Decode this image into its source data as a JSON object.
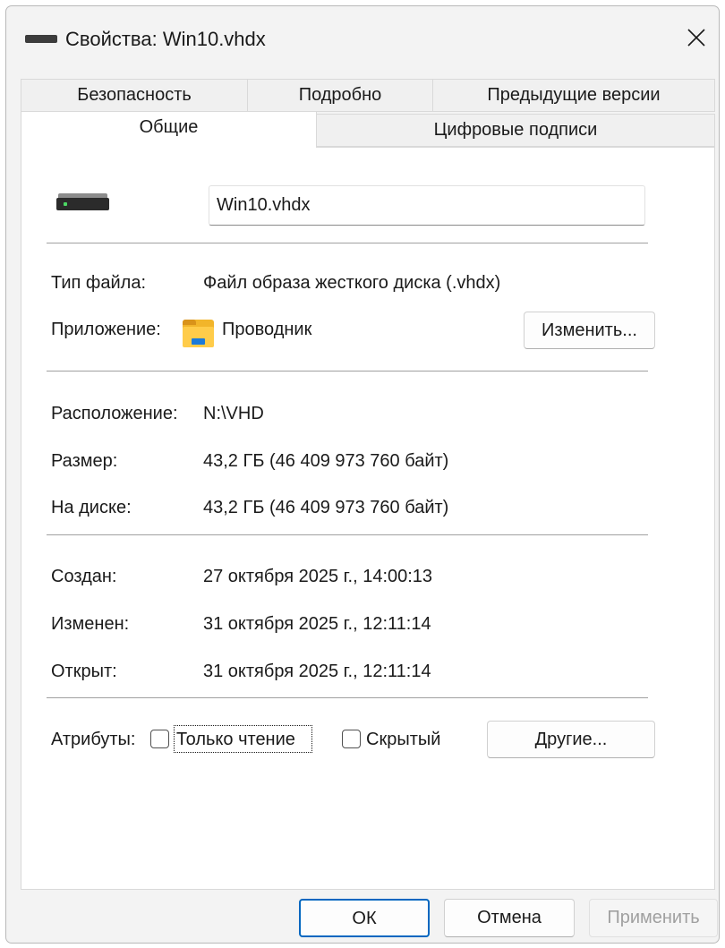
{
  "window": {
    "title": "Свойства: Win10.vhdx"
  },
  "tabs": {
    "row1": [
      {
        "label": "Безопасность"
      },
      {
        "label": "Подробно"
      },
      {
        "label": "Предыдущие версии"
      }
    ],
    "row2": [
      {
        "label": "Общие",
        "active": true
      },
      {
        "label": "Цифровые подписи"
      }
    ]
  },
  "general": {
    "file_name": "Win10.vhdx",
    "file_type_label": "Тип файла:",
    "file_type_value": "Файл образа жесткого диска (.vhdx)",
    "app_label": "Приложение:",
    "app_value": "Проводник",
    "change_button": "Изменить...",
    "location_label": "Расположение:",
    "location_value": "N:\\VHD",
    "size_label": "Размер:",
    "size_value": "43,2 ГБ (46 409 973 760 байт)",
    "disk_label": "На диске:",
    "disk_value": "43,2 ГБ (46 409 973 760 байт)",
    "created_label": "Создан:",
    "created_value": "27 октября 2025 г., 14:00:13",
    "modified_label": "Изменен:",
    "modified_value": "31 октября 2025 г., 12:11:14",
    "opened_label": "Открыт:",
    "opened_value": "31 октября 2025 г., 12:11:14",
    "attributes_label": "Атрибуты:",
    "readonly_label": "Только чтение",
    "readonly_checked": false,
    "hidden_label": "Скрытый",
    "hidden_checked": false,
    "other_button": "Другие..."
  },
  "footer": {
    "ok": "ОК",
    "cancel": "Отмена",
    "apply": "Применить"
  },
  "colors": {
    "window_bg": "#f3f3f3",
    "panel_bg": "#ffffff",
    "ok_border": "#0067c0",
    "disabled_text": "#a0a0a0",
    "folder_yellow": "#ffcc4a",
    "folder_blue": "#1b7ad9"
  },
  "icons": {
    "title": "drive-icon",
    "close": "close-icon",
    "file": "hard-drive-icon",
    "app": "file-explorer-icon"
  }
}
